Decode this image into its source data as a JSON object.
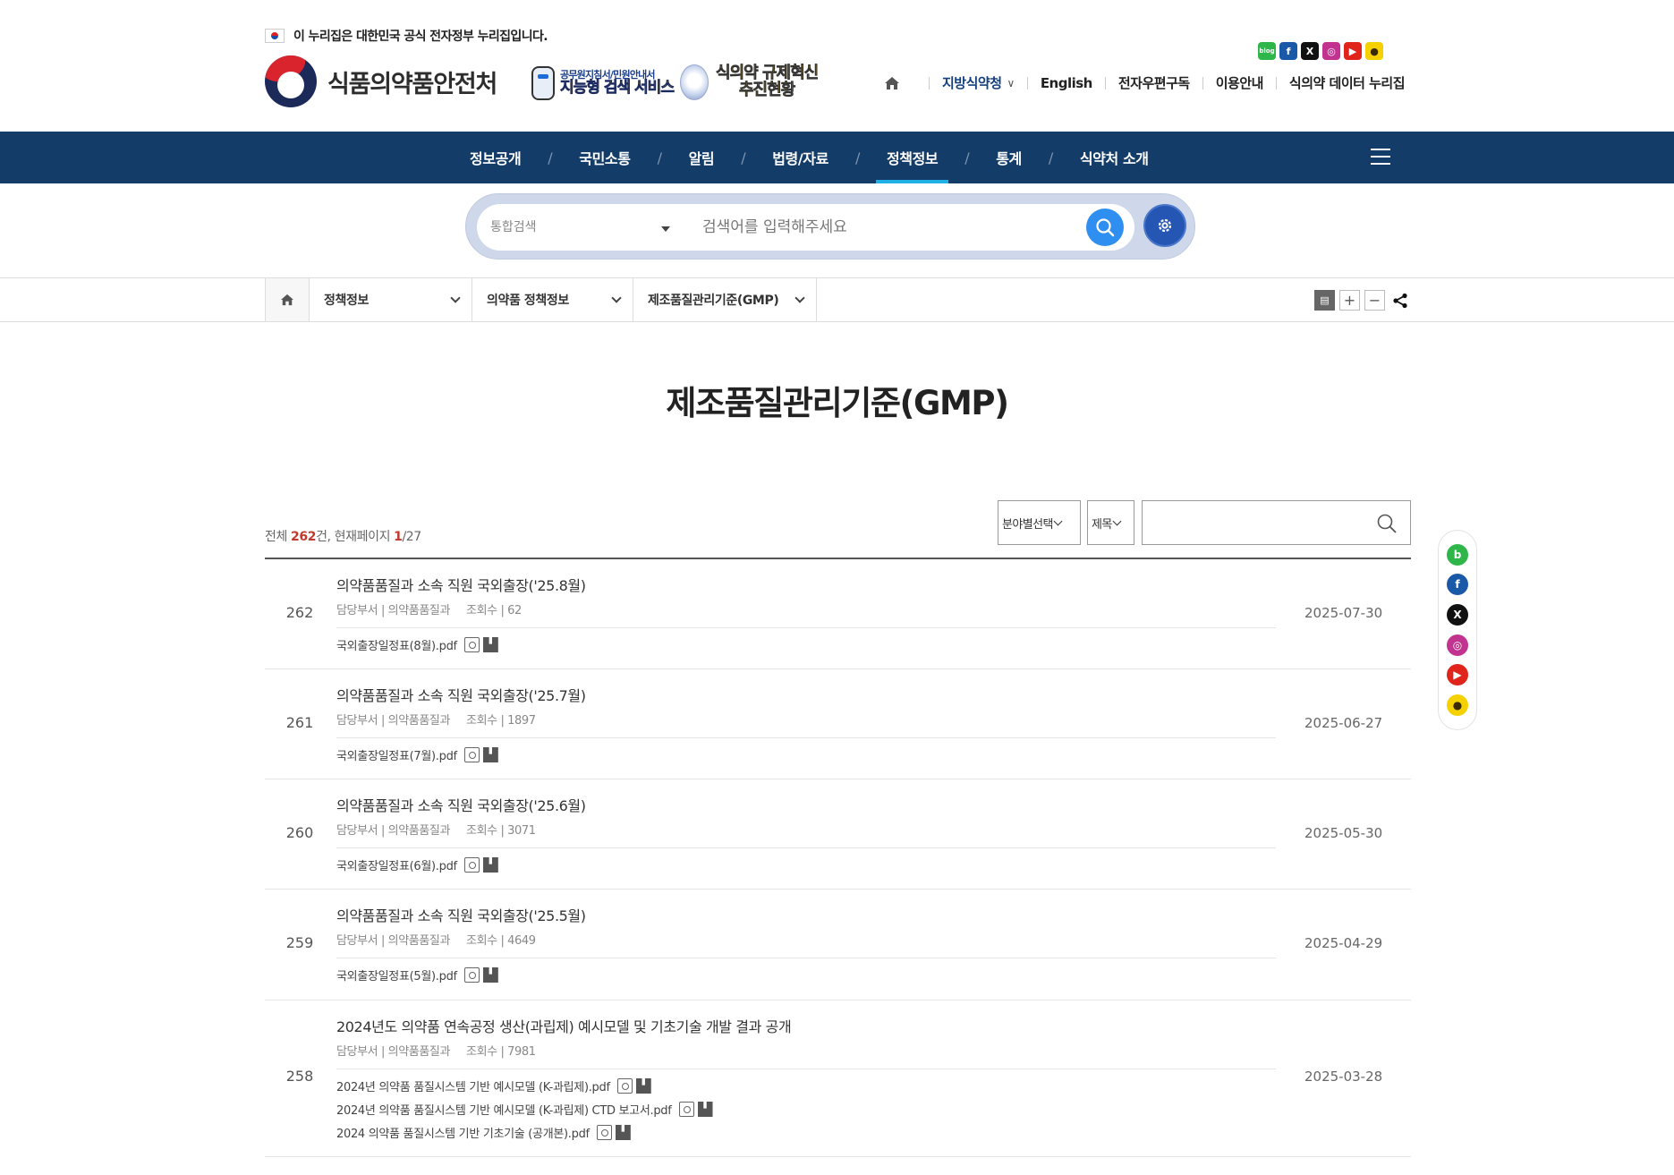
{
  "header": {
    "gov_notice": "이 누리집은 대한민국 공식 전자정부 누리집입니다.",
    "logo_text": "식품의약품안전처",
    "promo1_line1": "공무원지침서/민원안내서",
    "promo1_line2": "지능형 검색 서비스",
    "promo2_line1": "식의약 규제혁신",
    "promo2_line2": "추진현황",
    "util_links": [
      "지방식약청",
      "English",
      "전자우편구독",
      "이용안내",
      "식의약 데이터 누리집"
    ],
    "sns_icons": [
      "blog-icon",
      "facebook-icon",
      "x-icon",
      "instagram-icon",
      "youtube-icon",
      "kakao-icon"
    ]
  },
  "gnb": {
    "items": [
      "정보공개",
      "국민소통",
      "알림",
      "법령/자료",
      "정책정보",
      "통계",
      "식약처 소개"
    ],
    "active": "정책정보"
  },
  "search": {
    "category": "통합검색",
    "placeholder": "검색어를 입력해주세요"
  },
  "breadcrumb": {
    "items": [
      "정책정보",
      "의약품 정책정보",
      "제조품질관리기준(GMP)"
    ]
  },
  "page": {
    "title": "제조품질관리기준(GMP)"
  },
  "list": {
    "total_label": "전체",
    "total_count": "262",
    "total_unit": "건, 현재페이지",
    "current_page": "1",
    "total_pages": "/27",
    "filter_field": "분야별선택",
    "filter_type": "제목",
    "search_value": ""
  },
  "posts": [
    {
      "num": "262",
      "title": "의약품품질과 소속 직원 국외출장('25.8월)",
      "dept": "담당부서 | 의약품품질과",
      "views": "조회수 | 62",
      "date": "2025-07-30",
      "files": [
        "국외출장일정표(8월).pdf"
      ]
    },
    {
      "num": "261",
      "title": "의약품품질과 소속 직원 국외출장('25.7월)",
      "dept": "담당부서 | 의약품품질과",
      "views": "조회수 | 1897",
      "date": "2025-06-27",
      "files": [
        "국외출장일정표(7월).pdf"
      ]
    },
    {
      "num": "260",
      "title": "의약품품질과 소속 직원 국외출장('25.6월)",
      "dept": "담당부서 | 의약품품질과",
      "views": "조회수 | 3071",
      "date": "2025-05-30",
      "files": [
        "국외출장일정표(6월).pdf"
      ]
    },
    {
      "num": "259",
      "title": "의약품품질과 소속 직원 국외출장('25.5월)",
      "dept": "담당부서 | 의약품품질과",
      "views": "조회수 | 4649",
      "date": "2025-04-29",
      "files": [
        "국외출장일정표(5월).pdf"
      ]
    },
    {
      "num": "258",
      "title": "2024년도 의약품 연속공정 생산(과립제) 예시모델 및 기초기술 개발 결과 공개",
      "dept": "담당부서 | 의약품품질과",
      "views": "조회수 | 7981",
      "date": "2025-03-28",
      "files": [
        "2024년 의약품 품질시스템 기반 예시모델 (K-과립제).pdf",
        "2024년 의약품 품질시스템 기반 예시모델 (K-과립제) CTD 보고서.pdf",
        "2024 의약품 품질시스템 기반 기초기술 (공개본).pdf"
      ]
    }
  ],
  "side_sns": [
    "blog-icon",
    "facebook-icon",
    "x-icon",
    "instagram-icon",
    "youtube-icon",
    "kakao-icon"
  ],
  "colors": {
    "gnb_bg": "#143c68",
    "gnb_active": "#1fb0e6",
    "search_btn": "#2f8ff0",
    "setting_btn": "#2556b4",
    "count_accent": "#c0392b"
  }
}
